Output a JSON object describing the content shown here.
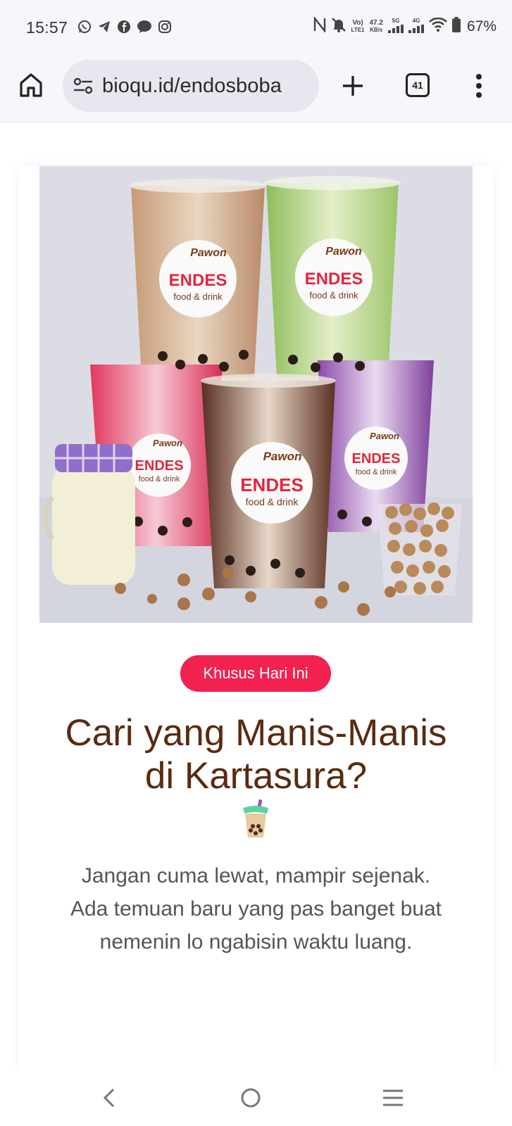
{
  "status_bar": {
    "time": "15:57",
    "network_speed": "47.2",
    "network_speed_unit": "KB/s",
    "volte_label": "Vo)",
    "lte_label": "LTE1",
    "signal_1_label": "5G",
    "signal_2_label": "4G",
    "battery_percent": "67%",
    "notification_icons": [
      "whatsapp-icon",
      "telegram-icon",
      "facebook-icon",
      "messenger-icon",
      "instagram-icon"
    ]
  },
  "browser": {
    "url": "bioqu.id/endosboba",
    "tab_count": "41"
  },
  "content": {
    "hero_image_alt": "boba-drinks-photo",
    "badge": "Khusus Hari Ini",
    "title": "Cari yang Manis-Manis di Kartasura?",
    "title_emoji": "bubble-tea",
    "description": "Jangan cuma lewat, mampir sejenak. Ada temuan baru yang pas banget buat nemenin lo ngabisin waktu luang.",
    "cup_label_top": "Pawon",
    "cup_label_brand": "ENDES",
    "cup_label_sub": "food & drink"
  },
  "colors": {
    "badge_bg": "#f2214f",
    "title": "#5a2a10",
    "description": "#555555"
  }
}
